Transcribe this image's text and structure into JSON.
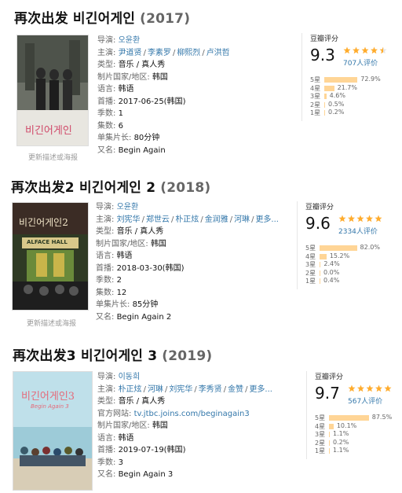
{
  "movies": [
    {
      "title": "再次出发 비긴어게인",
      "year": "(2017)",
      "poster": {
        "caption_lines": [
          "비긴어게인"
        ],
        "bg": "#5a5f57"
      },
      "poster_caption": "更新描述或海报",
      "director_label": "导演:",
      "director": "오윤환",
      "cast_label": "主演:",
      "cast": [
        "尹道贤",
        "李素罗",
        "柳熙烈",
        "卢洪哲"
      ],
      "genre_label": "类型:",
      "genre": "音乐 / 真人秀",
      "country_label": "制片国家/地区:",
      "country": "韩国",
      "language_label": "语言:",
      "language": "韩语",
      "premiere_label": "首播:",
      "premiere": "2017-06-25(韩国)",
      "season_label": "季数:",
      "season": "1",
      "episodes_label": "集数:",
      "episodes": "6",
      "runtime_label": "单集片长:",
      "runtime": "80分钟",
      "aka_label": "又名:",
      "aka": "Begin Again",
      "rating": {
        "title": "豆瓣评分",
        "score": "9.3",
        "stars": 4.5,
        "count": "707人评价",
        "dist": [
          {
            "label": "5星",
            "pct": "72.9%",
            "value": 72.9
          },
          {
            "label": "4星",
            "pct": "21.7%",
            "value": 21.7
          },
          {
            "label": "3星",
            "pct": "4.6%",
            "value": 4.6
          },
          {
            "label": "2星",
            "pct": "0.5%",
            "value": 0.5
          },
          {
            "label": "1星",
            "pct": "0.2%",
            "value": 0.2
          }
        ]
      }
    },
    {
      "title": "再次出发2 비긴어게인 2",
      "year": "(2018)",
      "poster": {
        "caption_lines": [
          "비긴어게인2",
          "ALFACE HALL"
        ],
        "bg": "#2f3a24"
      },
      "poster_caption": "更新描述或海报",
      "director_label": "导演:",
      "director": "오윤환",
      "cast_label": "主演:",
      "cast": [
        "刘宪华",
        "郑世云",
        "朴正炫",
        "金润雅",
        "河琳"
      ],
      "cast_more": "更多...",
      "genre_label": "类型:",
      "genre": "音乐 / 真人秀",
      "country_label": "制片国家/地区:",
      "country": "韩国",
      "language_label": "语言:",
      "language": "韩语",
      "premiere_label": "首播:",
      "premiere": "2018-03-30(韩国)",
      "season_label": "季数:",
      "season": "2",
      "episodes_label": "集数:",
      "episodes": "12",
      "runtime_label": "单集片长:",
      "runtime": "85分钟",
      "aka_label": "又名:",
      "aka": "Begin Again 2",
      "rating": {
        "title": "豆瓣评分",
        "score": "9.6",
        "stars": 5,
        "count": "2334人评价",
        "dist": [
          {
            "label": "5星",
            "pct": "82.0%",
            "value": 82.0
          },
          {
            "label": "4星",
            "pct": "15.2%",
            "value": 15.2
          },
          {
            "label": "3星",
            "pct": "2.4%",
            "value": 2.4
          },
          {
            "label": "2星",
            "pct": "0.0%",
            "value": 0.0
          },
          {
            "label": "1星",
            "pct": "0.4%",
            "value": 0.4
          }
        ]
      }
    },
    {
      "title": "再次出发3 비긴어게인 3",
      "year": "(2019)",
      "poster": {
        "caption_lines": [
          "비긴어게인3",
          "Begin Again 3"
        ],
        "bg": "#bfe0ea"
      },
      "director_label": "导演:",
      "director": "이동희",
      "cast_label": "主演:",
      "cast": [
        "朴正炫",
        "河琳",
        "刘宪华",
        "李秀贤",
        "金赞"
      ],
      "cast_more": "更多...",
      "genre_label": "类型:",
      "genre": "音乐 / 真人秀",
      "website_label": "官方网站:",
      "website": "tv.jtbc.joins.com/beginagain3",
      "country_label": "制片国家/地区:",
      "country": "韩国",
      "language_label": "语言:",
      "language": "韩语",
      "premiere_label": "首播:",
      "premiere": "2019-07-19(韩国)",
      "season_label": "季数:",
      "season": "3",
      "aka_label": "又名:",
      "aka": "Begin Again 3",
      "rating": {
        "title": "豆瓣评分",
        "score": "9.7",
        "stars": 5,
        "count": "567人评价",
        "dist": [
          {
            "label": "5星",
            "pct": "87.5%",
            "value": 87.5
          },
          {
            "label": "4星",
            "pct": "10.1%",
            "value": 10.1
          },
          {
            "label": "3星",
            "pct": "1.1%",
            "value": 1.1
          },
          {
            "label": "2星",
            "pct": "0.2%",
            "value": 0.2
          },
          {
            "label": "1星",
            "pct": "1.1%",
            "value": 1.1
          }
        ]
      }
    }
  ],
  "colors": {
    "link": "#3377aa",
    "star": "#ffac2d",
    "bar": "#ffd596"
  }
}
